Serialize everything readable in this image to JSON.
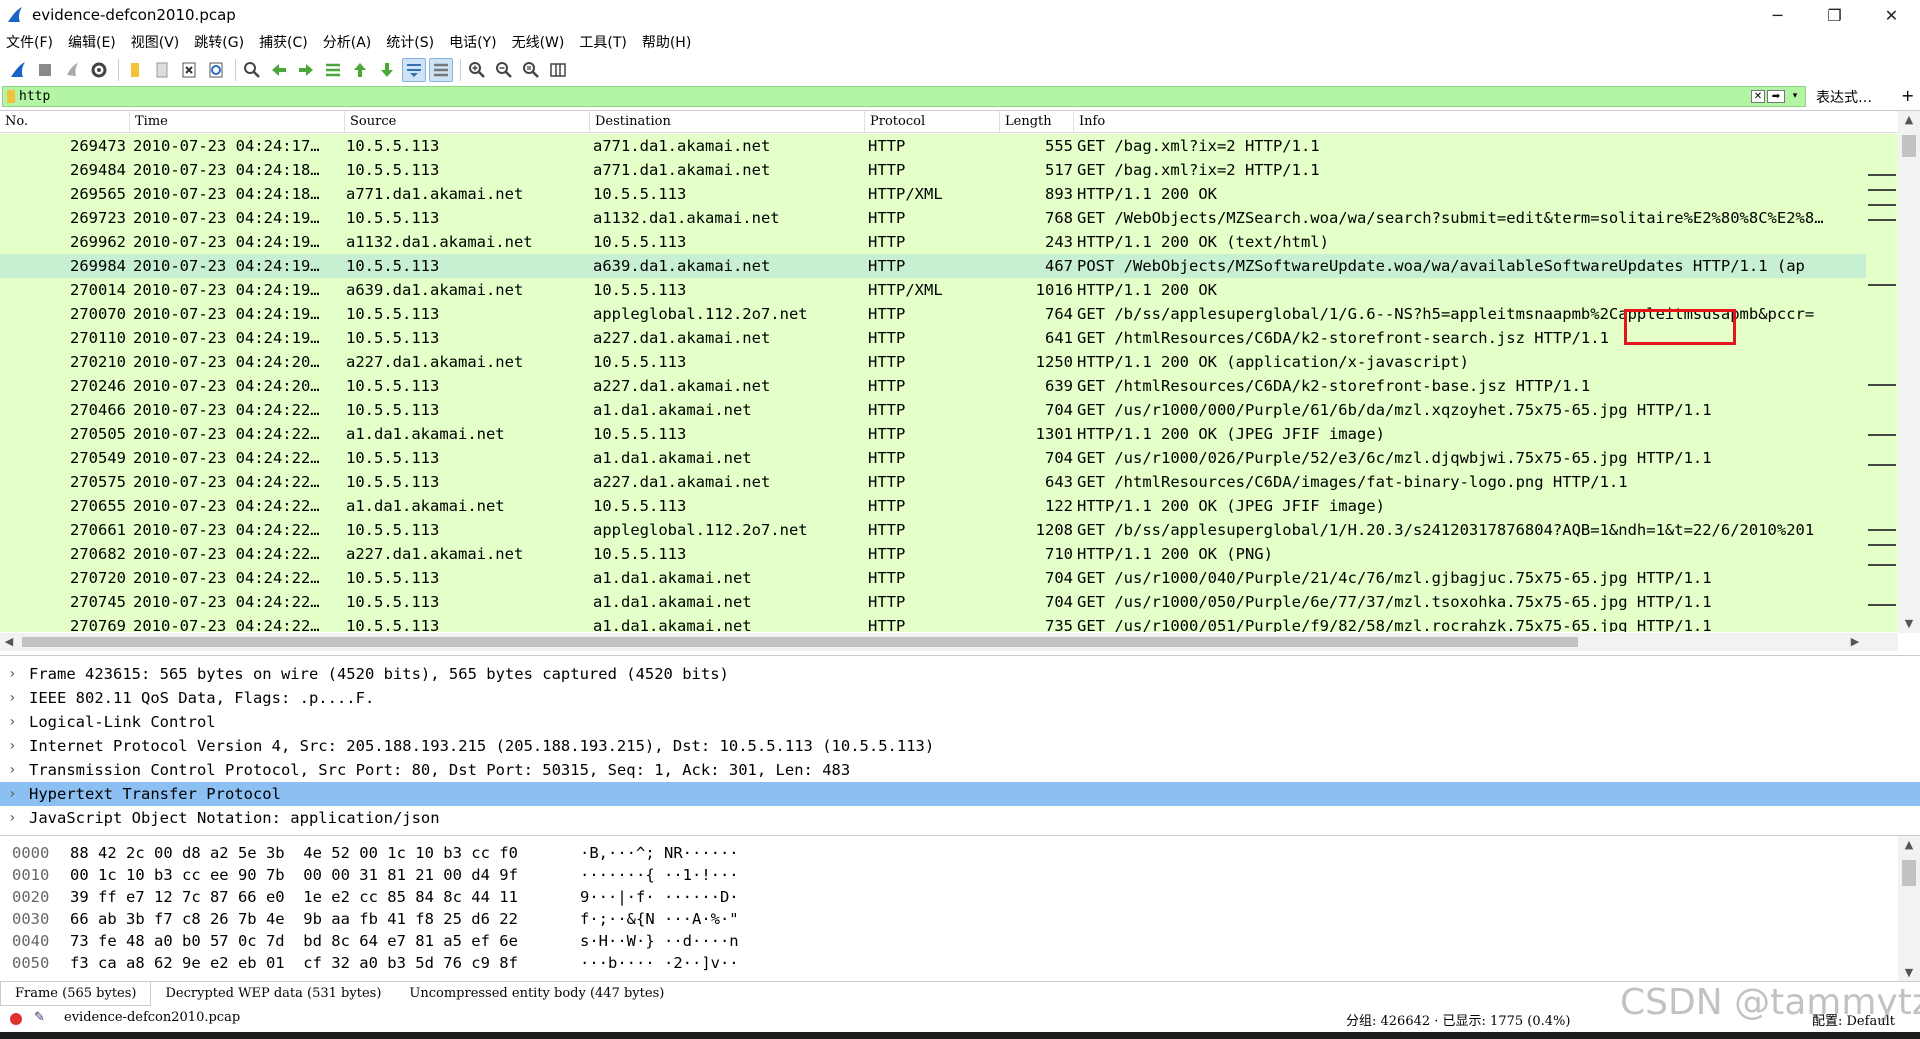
{
  "window": {
    "title": "evidence-defcon2010.pcap",
    "minimize": "─",
    "restore": "❐",
    "close": "✕"
  },
  "menu": [
    "文件(F)",
    "编辑(E)",
    "视图(V)",
    "跳转(G)",
    "捕获(C)",
    "分析(A)",
    "统计(S)",
    "电话(Y)",
    "无线(W)",
    "工具(T)",
    "帮助(H)"
  ],
  "filter": {
    "value": "http",
    "clear_glyph": "✕",
    "apply_glyph": "➡",
    "dropdown_glyph": "▾",
    "expression_label": "表达式…",
    "add_label": "+"
  },
  "columns": {
    "no": "No.",
    "time": "Time",
    "source": "Source",
    "destination": "Destination",
    "protocol": "Protocol",
    "length": "Length",
    "info": "Info"
  },
  "packets": [
    {
      "no": "269473",
      "time": "2010-07-23 04:24:17…",
      "src": "10.5.5.113",
      "dst": "a771.da1.akamai.net",
      "proto": "HTTP",
      "len": "555",
      "info": "GET /bag.xml?ix=2 HTTP/1.1"
    },
    {
      "no": "269484",
      "time": "2010-07-23 04:24:18…",
      "src": "10.5.5.113",
      "dst": "a771.da1.akamai.net",
      "proto": "HTTP",
      "len": "517",
      "info": "GET /bag.xml?ix=2 HTTP/1.1"
    },
    {
      "no": "269565",
      "time": "2010-07-23 04:24:18…",
      "src": "a771.da1.akamai.net",
      "dst": "10.5.5.113",
      "proto": "HTTP/XML",
      "len": "893",
      "info": "HTTP/1.1 200 OK"
    },
    {
      "no": "269723",
      "time": "2010-07-23 04:24:19…",
      "src": "10.5.5.113",
      "dst": "a1132.da1.akamai.net",
      "proto": "HTTP",
      "len": "768",
      "info": "GET /WebObjects/MZSearch.woa/wa/search?submit=edit&term=solitaire%E2%80%8C%E2%8…"
    },
    {
      "no": "269962",
      "time": "2010-07-23 04:24:19…",
      "src": "a1132.da1.akamai.net",
      "dst": "10.5.5.113",
      "proto": "HTTP",
      "len": "243",
      "info": "HTTP/1.1 200 OK  (text/html)"
    },
    {
      "no": "269984",
      "time": "2010-07-23 04:24:19…",
      "src": "10.5.5.113",
      "dst": "a639.da1.akamai.net",
      "proto": "HTTP",
      "len": "467",
      "info": "POST /WebObjects/MZSoftwareUpdate.woa/wa/availableSoftwareUpdates HTTP/1.1  (ap"
    },
    {
      "no": "270014",
      "time": "2010-07-23 04:24:19…",
      "src": "a639.da1.akamai.net",
      "dst": "10.5.5.113",
      "proto": "HTTP/XML",
      "len": "1016",
      "info": "HTTP/1.1 200 OK"
    },
    {
      "no": "270070",
      "time": "2010-07-23 04:24:19…",
      "src": "10.5.5.113",
      "dst": "appleglobal.112.2o7.net",
      "proto": "HTTP",
      "len": "764",
      "info": "GET /b/ss/applesuperglobal/1/G.6--NS?h5=appleitmsnaapmb%2Cappleitmsusapmb&pccr="
    },
    {
      "no": "270110",
      "time": "2010-07-23 04:24:19…",
      "src": "10.5.5.113",
      "dst": "a227.da1.akamai.net",
      "proto": "HTTP",
      "len": "641",
      "info": "GET /htmlResources/C6DA/k2-storefront-search.jsz HTTP/1.1"
    },
    {
      "no": "270210",
      "time": "2010-07-23 04:24:20…",
      "src": "a227.da1.akamai.net",
      "dst": "10.5.5.113",
      "proto": "HTTP",
      "len": "1250",
      "info": "HTTP/1.1 200 OK  (application/x-javascript)"
    },
    {
      "no": "270246",
      "time": "2010-07-23 04:24:20…",
      "src": "10.5.5.113",
      "dst": "a227.da1.akamai.net",
      "proto": "HTTP",
      "len": "639",
      "info": "GET /htmlResources/C6DA/k2-storefront-base.jsz HTTP/1.1"
    },
    {
      "no": "270466",
      "time": "2010-07-23 04:24:22…",
      "src": "10.5.5.113",
      "dst": "a1.da1.akamai.net",
      "proto": "HTTP",
      "len": "704",
      "info": "GET /us/r1000/000/Purple/61/6b/da/mzl.xqzoyhet.75x75-65.jpg HTTP/1.1"
    },
    {
      "no": "270505",
      "time": "2010-07-23 04:24:22…",
      "src": "a1.da1.akamai.net",
      "dst": "10.5.5.113",
      "proto": "HTTP",
      "len": "1301",
      "info": "HTTP/1.1 200 OK  (JPEG JFIF image)"
    },
    {
      "no": "270549",
      "time": "2010-07-23 04:24:22…",
      "src": "10.5.5.113",
      "dst": "a1.da1.akamai.net",
      "proto": "HTTP",
      "len": "704",
      "info": "GET /us/r1000/026/Purple/52/e3/6c/mzl.djqwbjwi.75x75-65.jpg HTTP/1.1"
    },
    {
      "no": "270575",
      "time": "2010-07-23 04:24:22…",
      "src": "10.5.5.113",
      "dst": "a227.da1.akamai.net",
      "proto": "HTTP",
      "len": "643",
      "info": "GET /htmlResources/C6DA/images/fat-binary-logo.png HTTP/1.1"
    },
    {
      "no": "270655",
      "time": "2010-07-23 04:24:22…",
      "src": "a1.da1.akamai.net",
      "dst": "10.5.5.113",
      "proto": "HTTP",
      "len": "122",
      "info": "HTTP/1.1 200 OK  (JPEG JFIF image)"
    },
    {
      "no": "270661",
      "time": "2010-07-23 04:24:22…",
      "src": "10.5.5.113",
      "dst": "appleglobal.112.2o7.net",
      "proto": "HTTP",
      "len": "1208",
      "info": "GET /b/ss/applesuperglobal/1/H.20.3/s24120317876804?AQB=1&ndh=1&t=22/6/2010%201"
    },
    {
      "no": "270682",
      "time": "2010-07-23 04:24:22…",
      "src": "a227.da1.akamai.net",
      "dst": "10.5.5.113",
      "proto": "HTTP",
      "len": "710",
      "info": "HTTP/1.1 200 OK  (PNG)"
    },
    {
      "no": "270720",
      "time": "2010-07-23 04:24:22…",
      "src": "10.5.5.113",
      "dst": "a1.da1.akamai.net",
      "proto": "HTTP",
      "len": "704",
      "info": "GET /us/r1000/040/Purple/21/4c/76/mzl.gjbagjuc.75x75-65.jpg HTTP/1.1"
    },
    {
      "no": "270745",
      "time": "2010-07-23 04:24:22…",
      "src": "10.5.5.113",
      "dst": "a1.da1.akamai.net",
      "proto": "HTTP",
      "len": "704",
      "info": "GET /us/r1000/050/Purple/6e/77/37/mzl.tsoxohka.75x75-65.jpg HTTP/1.1"
    },
    {
      "no": "270769",
      "time": "2010-07-23 04:24:22…",
      "src": "10.5.5.113",
      "dst": "a1.da1.akamai.net",
      "proto": "HTTP",
      "len": "735",
      "info": "GET /us/r1000/051/Purple/f9/82/58/mzl.rocrahzk.75x75-65.jpg HTTP/1.1"
    }
  ],
  "selected_packet_index": 5,
  "details": [
    "Frame 423615: 565 bytes on wire (4520 bits), 565 bytes captured (4520 bits)",
    "IEEE 802.11 QoS Data, Flags: .p....F.",
    "Logical-Link Control",
    "Internet Protocol Version 4, Src: 205.188.193.215 (205.188.193.215), Dst: 10.5.5.113 (10.5.5.113)",
    "Transmission Control Protocol, Src Port: 80, Dst Port: 50315, Seq: 1, Ack: 301, Len: 483",
    "Hypertext Transfer Protocol",
    "JavaScript Object Notation: application/json"
  ],
  "selected_detail_index": 5,
  "hex": [
    {
      "offset": "0000",
      "bytes": "88 42 2c 00 d8 a2 5e 3b  4e 52 00 1c 10 b3 cc f0",
      "ascii": "·B,···^; NR······"
    },
    {
      "offset": "0010",
      "bytes": "00 1c 10 b3 cc ee 90 7b  00 00 31 81 21 00 d4 9f",
      "ascii": "·······{ ··1·!···"
    },
    {
      "offset": "0020",
      "bytes": "39 ff e7 12 7c 87 66 e0  1e e2 cc 85 84 8c 44 11",
      "ascii": "9···|·f· ······D·"
    },
    {
      "offset": "0030",
      "bytes": "66 ab 3b f7 c8 26 7b 4e  9b aa fb 41 f8 25 d6 22",
      "ascii": "f·;··&{N ···A·%·\""
    },
    {
      "offset": "0040",
      "bytes": "73 fe 48 a0 b0 57 0c 7d  bd 8c 64 e7 81 a5 ef 6e",
      "ascii": "s·H··W·} ··d····n"
    },
    {
      "offset": "0050",
      "bytes": "f3 ca a8 62 9e e2 eb 01  cf 32 a0 b3 5d 76 c9 8f",
      "ascii": "···b···· ·2··]v··"
    }
  ],
  "byte_tabs": [
    "Frame (565 bytes)",
    "Decrypted WEP data (531 bytes)",
    "Uncompressed entity body (447 bytes)"
  ],
  "status": {
    "file": "evidence-defcon2010.pcap",
    "stats": "分组: 426642 · 已显示: 1775 (0.4%)",
    "profile": "配置: Default",
    "edit_glyph": "✎"
  },
  "watermark": "CSDN @tammytzc",
  "colors": {
    "http_row": "#e4ffc7",
    "selected_row": "#c7efd1",
    "filter_valid": "#b3f5a5",
    "detail_selected": "#8dc0f2",
    "annotation_box": "#e8141b"
  }
}
